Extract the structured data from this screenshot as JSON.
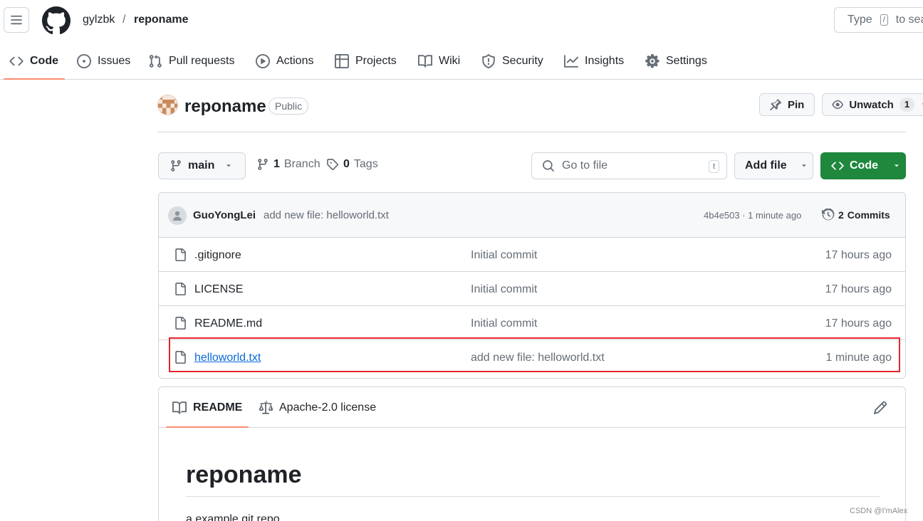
{
  "header": {
    "owner": "gylzbk",
    "separator": "/",
    "repo": "reponame",
    "search_prefix": "Type",
    "search_key": "/",
    "search_suffix": "to search"
  },
  "nav": {
    "tabs": [
      {
        "label": "Code",
        "icon": "code-icon",
        "active": true
      },
      {
        "label": "Issues",
        "icon": "issue-icon"
      },
      {
        "label": "Pull requests",
        "icon": "pull-request-icon"
      },
      {
        "label": "Actions",
        "icon": "play-icon"
      },
      {
        "label": "Projects",
        "icon": "table-icon"
      },
      {
        "label": "Wiki",
        "icon": "book-icon"
      },
      {
        "label": "Security",
        "icon": "shield-icon"
      },
      {
        "label": "Insights",
        "icon": "graph-icon"
      },
      {
        "label": "Settings",
        "icon": "gear-icon"
      }
    ]
  },
  "repo": {
    "name": "reponame",
    "visibility": "Public",
    "pin_label": "Pin",
    "watch_label": "Unwatch",
    "watch_count": "1"
  },
  "filenav": {
    "branch": "main",
    "branch_count": "1",
    "branch_label": "Branch",
    "tag_count": "0",
    "tag_label": "Tags",
    "goto_placeholder": "Go to file",
    "goto_key": "t",
    "add_file_label": "Add file",
    "code_label": "Code"
  },
  "latest_commit": {
    "author": "GuoYongLei",
    "message": "add new file: helloworld.txt",
    "sha_time": "4b4e503 · 1 minute ago",
    "commits_count": "2",
    "commits_label": "Commits"
  },
  "files": [
    {
      "name": ".gitignore",
      "commit": "Initial commit",
      "age": "17 hours ago"
    },
    {
      "name": "LICENSE",
      "commit": "Initial commit",
      "age": "17 hours ago"
    },
    {
      "name": "README.md",
      "commit": "Initial commit",
      "age": "17 hours ago"
    },
    {
      "name": "helloworld.txt",
      "commit": "add new file: helloworld.txt",
      "age": "1 minute ago",
      "highlighted": true
    }
  ],
  "readme": {
    "tab_readme": "README",
    "tab_license": "Apache-2.0 license",
    "heading": "reponame",
    "body": "a example git repo"
  },
  "watermark": "CSDN @I'mAlex",
  "colors": {
    "accent_underline": "#fd8c73",
    "code_button": "#1f883d",
    "link": "#0969da",
    "highlight_box": "#e5242b"
  }
}
